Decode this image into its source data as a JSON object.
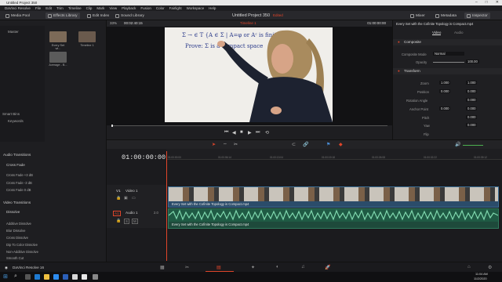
{
  "window": {
    "title": "Untitled Project 350"
  },
  "menu": [
    "DaVinci Resolve",
    "File",
    "Edit",
    "Trim",
    "Timeline",
    "Clip",
    "Mark",
    "View",
    "Playback",
    "Fusion",
    "Color",
    "Fairlight",
    "Workspace",
    "Help"
  ],
  "toolbar": {
    "media_pool": "Media Pool",
    "effects_library": "Effects Library",
    "edit_index": "Edit Index",
    "sound_library": "Sound Library",
    "project_title": "Untitled Project 350",
    "project_status": "Edited",
    "mixer": "Mixer",
    "metadata": "Metadata",
    "inspector": "Inspector"
  },
  "media_pool": {
    "master": "Master",
    "smart_bins": "Smart Bins",
    "keywords": "Keywords",
    "clips": [
      {
        "name": "Every Set wi...",
        "color": "#7c6a58"
      },
      {
        "name": "Timeline 1",
        "color": "#6a5a4d"
      },
      {
        "name": "Average - B...",
        "color": "#5b5b5b"
      }
    ]
  },
  "viewer": {
    "zoom": "33%",
    "timecode_left": "00:02:40:15",
    "timeline_name": "Timeline 1",
    "timecode_right": "01:00:00:00",
    "whiteboard_line1": "Σ → ∈ T {A ∈ Σ | A=φ or Aᶜ is finite",
    "whiteboard_line2": "Prove: Σ is a compact space"
  },
  "inspector": {
    "clip_name": "Every Set with the Cofinite Topology is Compact.mp4",
    "tab_video": "Video",
    "tab_audio": "Audio",
    "composite": "Composite",
    "composite_mode_label": "Composite Mode",
    "composite_mode_value": "Normal",
    "opacity_label": "Opacity",
    "opacity_value": "100.00",
    "transform": "Transform",
    "zoom_label": "Zoom",
    "zoom_x": "1.000",
    "zoom_y": "1.000",
    "position_label": "Position",
    "position_x": "0.000",
    "position_y": "0.000",
    "rotation_label": "Rotation Angle",
    "rotation_value": "0.000",
    "anchor_label": "Anchor Point",
    "anchor_x": "0.000",
    "anchor_y": "0.000",
    "pitch_label": "Pitch",
    "pitch_value": "0.000",
    "yaw_label": "Yaw",
    "yaw_value": "0.000",
    "flip_label": "Flip"
  },
  "effects": {
    "audio_transitions": "Audio Transitions",
    "cross_fade_head": "Cross Fade",
    "audio_items": [
      "Cross Fade +3 dB",
      "Cross Fade -3 dB",
      "Cross Fade 0 dB"
    ],
    "video_transitions": "Video Transitions",
    "dissolve_head": "Dissolve",
    "video_items": [
      "Additive Dissolve",
      "Blur Dissolve",
      "Cross Dissolve",
      "Dip To Color Dissolve",
      "Non-Additive Dissolve",
      "Smooth Cut"
    ]
  },
  "timeline": {
    "timecode": "01:00:00:00",
    "ticks": [
      "01:00:00:00",
      "01:00:06:14",
      "01:00:13:04",
      "01:00:19:18",
      "01:00:26:08",
      "01:00:32:22",
      "01:00:39:12"
    ],
    "v1_label": "V1",
    "v1_name": "Video 1",
    "a1_label": "A1",
    "a1_name": "Audio 1",
    "a1_level": "2.0",
    "clip_name": "Every Set with the Cofinite Topology is Compact.mp4"
  },
  "pagenav": {
    "app_name": "DaVinci Resolve 16"
  },
  "taskbar": {
    "time": "11:04 AM",
    "date": "11/2/2020"
  },
  "colors": {
    "accent_red": "#e0452a",
    "video_clip": "#2b4c6a",
    "audio_clip": "#1e4a3b"
  }
}
